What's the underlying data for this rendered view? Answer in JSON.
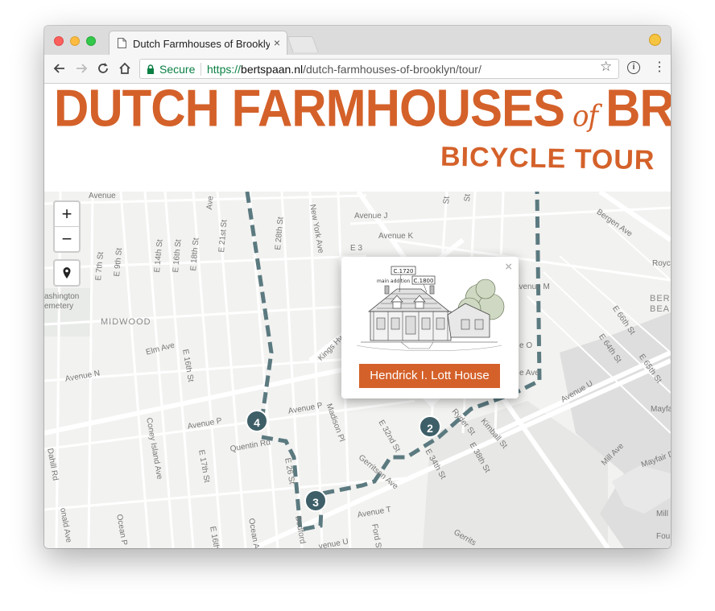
{
  "browser": {
    "tab_title": "Dutch Farmhouses of Brooklyn",
    "tab_close": "×",
    "secure_label": "Secure",
    "url_scheme": "https://",
    "url_host": "bertspaan.nl",
    "url_path": "/dutch-farmhouses-of-brooklyn/tour/",
    "star": "☆",
    "info": "i",
    "menu": "⋮"
  },
  "banner": {
    "title_part1": "DUTCH FARMHOUSES",
    "title_of": "of",
    "title_part2": "BROOKLYN",
    "subtitle": "BICYCLE TOUR"
  },
  "map_controls": {
    "zoom_in": "+",
    "zoom_out": "−"
  },
  "map_labels": {
    "avenue_top_left": "Avenue",
    "e7": "E 7th St",
    "e9": "E 9th St",
    "e14": "E 14th St",
    "e16": "E 16th St",
    "e18": "E 18th St",
    "ave": "Ave",
    "e21": "E 21st St",
    "e28": "E 28th St",
    "newyork": "New York Ave",
    "e3": "E 3",
    "avej": "Avenue J",
    "avek": "Avenue K",
    "st1": "St",
    "st2": "St",
    "bergen": "Bergen Ave",
    "royce": "Royce",
    "avem": "Avenue M",
    "berg1": "BERG",
    "berg2": "BEA",
    "e66": "E 66th St",
    "e64": "E 64th St",
    "e65": "E 65th St",
    "washington1": "ashington",
    "washington2": "emetery",
    "midwood": "MIDWOOD",
    "elm": "Elm Ave",
    "kings": "Kings Hwy",
    "e16b": "E 16th St",
    "aven": "Avenue N",
    "coney": "Coney Island Ave",
    "avep": "Avenue P",
    "avep2": "Avenue P",
    "quentin": "Quentin Rd",
    "e17": "E 17th St",
    "e26": "E 26 St",
    "madison": "Madison Pl",
    "e32": "E 32nd St",
    "e34": "E 34th St",
    "e38": "E 38th St",
    "kimball": "Kimball St",
    "ryder": "Ryder St",
    "avenue_u": "Avenue U",
    "mill": "Mill Ave",
    "mayfair": "Mayfair",
    "mayfair2": "Mayfair Dr",
    "gerritsen": "Gerritsen Ave",
    "dahill": "Dahill Rd",
    "donald": "onald Ave",
    "ocean_p": "Ocean P",
    "e16c": "E 16th",
    "ocean_ave": "Ocean Ave",
    "bedford": "Bedford",
    "avet": "Avenue T",
    "ford": "Ford St",
    "aveu2": "venue U",
    "ave_mid": "e Ave",
    "o_label": "e O",
    "mill2": "Mill",
    "fou": "Fou",
    "gerritsen2": "Gerrits",
    "mayf": "Mayf"
  },
  "markers": [
    "2",
    "3",
    "4"
  ],
  "popup": {
    "close": "×",
    "house_name": "Hendrick I. Lott House",
    "sketch_label_1": "C.1720",
    "sketch_label_2": "main addition",
    "sketch_label_3": "C.1800"
  },
  "colors": {
    "accent": "#d4612a",
    "route": "#5b7a80",
    "marker": "#3e5f68"
  }
}
